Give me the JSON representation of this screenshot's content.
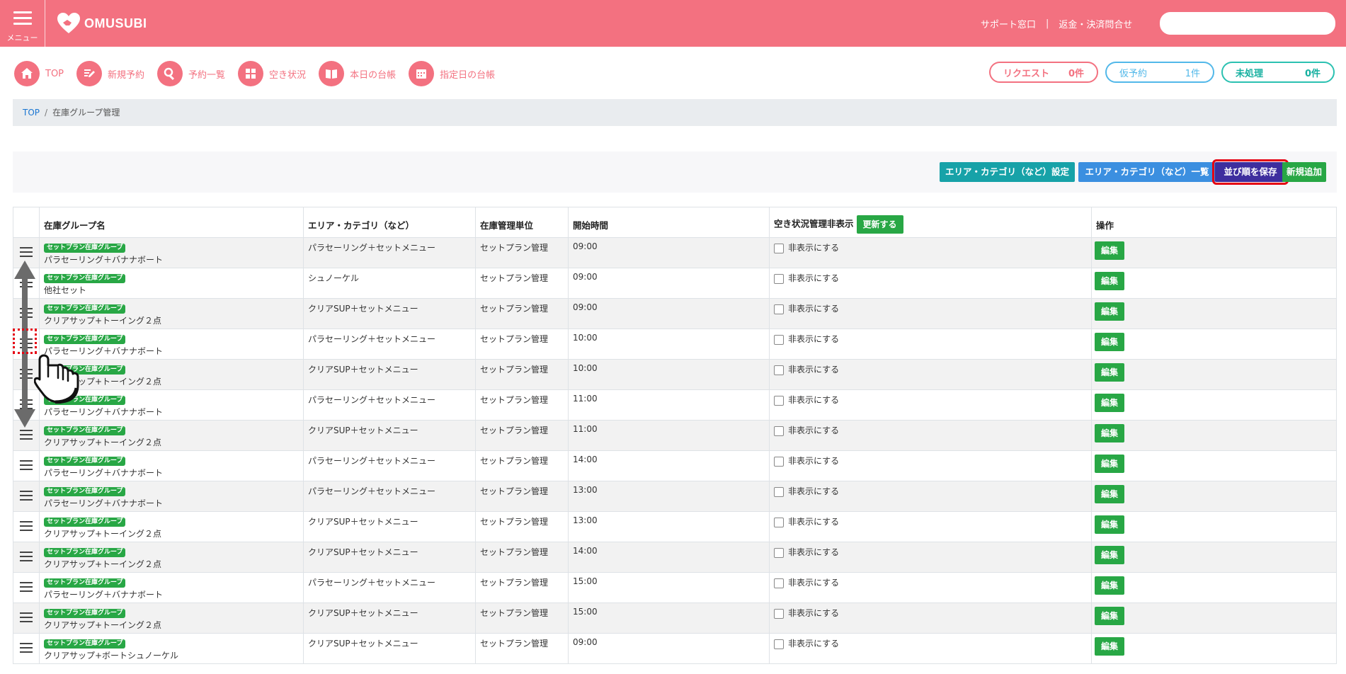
{
  "header": {
    "menu_label": "メニュー",
    "logo_text": "OMUSUBI",
    "support_link": "サポート窓口",
    "separator": "|",
    "refund_link": "返金・決済問合せ",
    "search_placeholder": ""
  },
  "quicknav": [
    {
      "label": "TOP",
      "icon": "home-icon"
    },
    {
      "label": "新規予約",
      "icon": "pencil-icon"
    },
    {
      "label": "予約一覧",
      "icon": "search-icon"
    },
    {
      "label": "空き状況",
      "icon": "grid-icon"
    },
    {
      "label": "本日の台帳",
      "icon": "book-icon"
    },
    {
      "label": "指定日の台帳",
      "icon": "calendar-icon"
    }
  ],
  "status": {
    "request_label": "リクエスト",
    "request_count": "0件",
    "tentative_label": "仮予約",
    "tentative_count": "1件",
    "unprocessed_label": "未処理",
    "unprocessed_count": "0件"
  },
  "breadcrumb": {
    "home": "TOP",
    "divider": "/",
    "current": "在庫グループ管理"
  },
  "toolbar": {
    "area_settings": "エリア・カテゴリ（など）設定",
    "area_list": "エリア・カテゴリ（など）一覧",
    "save_order": "並び順を保存",
    "add_new": "新規追加"
  },
  "table": {
    "headers": {
      "name": "在庫グループ名",
      "area": "エリア・カテゴリ（など）",
      "unit": "在庫管理単位",
      "start": "開始時間",
      "hide": "空き状況管理非表示",
      "update_button": "更新する",
      "ops": "操作"
    },
    "badge": "セットプラン在庫グループ",
    "checkbox_label": "非表示にする",
    "edit_label": "編集",
    "rows": [
      {
        "name": "パラセーリング＋バナナボート",
        "area": "パラセーリング＋セットメニュー",
        "unit": "セットプラン管理",
        "start": "09:00"
      },
      {
        "name": "他社セット",
        "area": "シュノーケル",
        "unit": "セットプラン管理",
        "start": "09:00"
      },
      {
        "name": "クリアサップ+トーイング２点",
        "area": "クリアSUP＋セットメニュー",
        "unit": "セットプラン管理",
        "start": "09:00"
      },
      {
        "name": "パラセーリング＋バナナボート",
        "area": "パラセーリング＋セットメニュー",
        "unit": "セットプラン管理",
        "start": "10:00"
      },
      {
        "name": "クリアサップ+トーイング２点",
        "area": "クリアSUP＋セットメニュー",
        "unit": "セットプラン管理",
        "start": "10:00"
      },
      {
        "name": "パラセーリング＋バナナボート",
        "area": "パラセーリング＋セットメニュー",
        "unit": "セットプラン管理",
        "start": "11:00"
      },
      {
        "name": "クリアサップ+トーイング２点",
        "area": "クリアSUP＋セットメニュー",
        "unit": "セットプラン管理",
        "start": "11:00"
      },
      {
        "name": "パラセーリング＋バナナボート",
        "area": "パラセーリング＋セットメニュー",
        "unit": "セットプラン管理",
        "start": "14:00"
      },
      {
        "name": "パラセーリング＋バナナボート",
        "area": "パラセーリング＋セットメニュー",
        "unit": "セットプラン管理",
        "start": "13:00"
      },
      {
        "name": "クリアサップ+トーイング２点",
        "area": "クリアSUP＋セットメニュー",
        "unit": "セットプラン管理",
        "start": "13:00"
      },
      {
        "name": "クリアサップ+トーイング２点",
        "area": "クリアSUP＋セットメニュー",
        "unit": "セットプラン管理",
        "start": "14:00"
      },
      {
        "name": "パラセーリング＋バナナボート",
        "area": "パラセーリング＋セットメニュー",
        "unit": "セットプラン管理",
        "start": "15:00"
      },
      {
        "name": "クリアサップ+トーイング２点",
        "area": "クリアSUP＋セットメニュー",
        "unit": "セットプラン管理",
        "start": "15:00"
      },
      {
        "name": "クリアサップ+ボートシュノーケル",
        "area": "クリアSUP＋セットメニュー",
        "unit": "セットプラン管理",
        "start": "09:00"
      }
    ]
  },
  "colors": {
    "brand": "#f37180",
    "green": "#28a745",
    "teal": "#17a2a8",
    "blue": "#3b8fe0",
    "indigo": "#3e2e9e",
    "highlight": "#e50012"
  }
}
